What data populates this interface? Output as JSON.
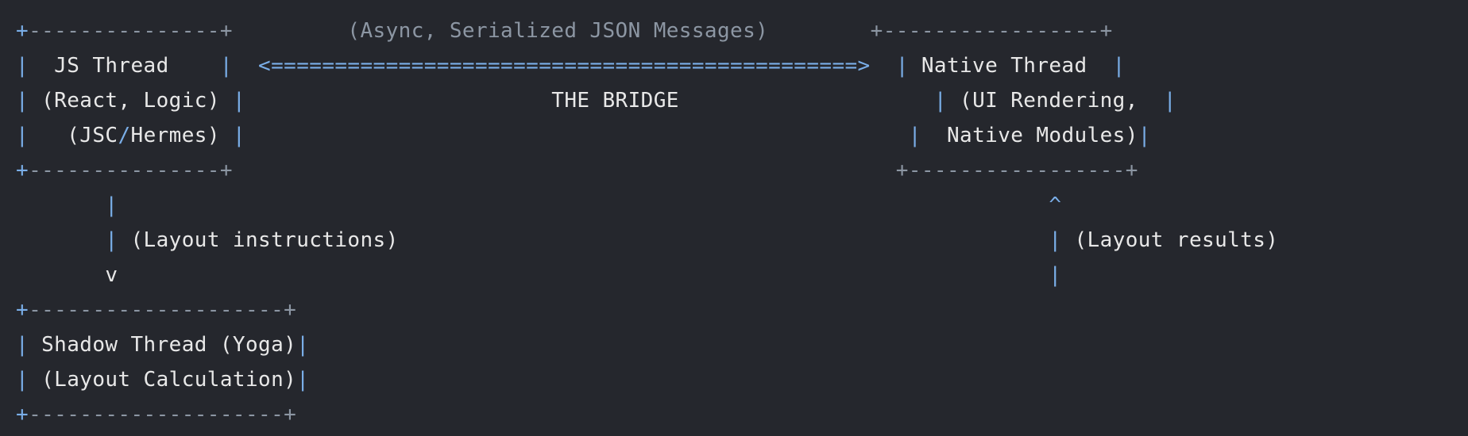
{
  "colors": {
    "background": "#25272d",
    "text": "#e8e8e8",
    "accent": "#7aaee8",
    "muted": "#8c96a3"
  },
  "bridge": {
    "caption": "(Async, Serialized JSON Messages)",
    "arrow": "<==============================================>",
    "label": "THE BRIDGE"
  },
  "js_thread": {
    "line1": "  JS Thread    ",
    "line2": "(React, Logic) ",
    "line3_pre": "  (JSC",
    "line3_sep": "/",
    "line3_post": "Hermes) "
  },
  "native_thread": {
    "line1": " Native Thread  ",
    "line2": "(UI Rendering,  ",
    "line3": " Native Modules)"
  },
  "layout_instructions": {
    "label": "(Layout instructions)",
    "arrow_head": "v"
  },
  "layout_results": {
    "label": "(Layout results)",
    "arrow_head": "^"
  },
  "shadow_thread": {
    "line1": " Shadow Thread (Yoga)",
    "line2": " (Layout Calculation)"
  }
}
